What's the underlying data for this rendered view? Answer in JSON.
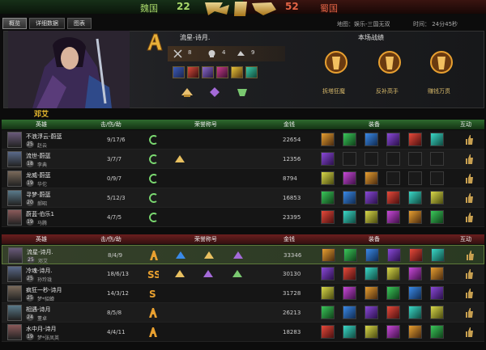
{
  "score": {
    "left_team": "魏国",
    "left_score": "22",
    "right_score": "52",
    "right_team": "蜀国"
  },
  "tabs": [
    {
      "label": "概览"
    },
    {
      "label": "详细数据"
    },
    {
      "label": "图表"
    }
  ],
  "map_info": "地图：娱乐-三国无双",
  "time_info": "时间：  24分45秒",
  "player": {
    "name": "流星-诗月.",
    "kills": "8",
    "deaths": "4",
    "assists": "9"
  },
  "honor_section": {
    "title": "本场战绩",
    "medals": [
      "拆塔狂魔",
      "反补高手",
      "赚钱万贯"
    ]
  },
  "team_hero_label": "邓艾",
  "headers": {
    "hero": "英雄",
    "kda": "击/伤/助",
    "honor": "荣誉称号",
    "gold": "金钱",
    "equip": "装备",
    "interact": "互动"
  },
  "team_green": [
    {
      "name": "不浪浮云-蔚蓝",
      "level": "25",
      "hero": "赵云",
      "kda": "9/17/6",
      "gold": "22654"
    },
    {
      "name": "流世-蔚蓝",
      "level": "18",
      "hero": "李典",
      "kda": "3/7/7",
      "gold": "12356"
    },
    {
      "name": "龙威-蔚蓝",
      "level": "19",
      "hero": "华佗",
      "kda": "0/9/7",
      "gold": "8794"
    },
    {
      "name": "寻梦-蔚蓝",
      "level": "20",
      "hero": "郝昭",
      "kda": "5/12/3",
      "gold": "16853"
    },
    {
      "name": "蔚蓝-伯乐1",
      "level": "19",
      "hero": "马腾",
      "kda": "4/7/5",
      "gold": "23395"
    }
  ],
  "team_red": [
    {
      "name": "流星-诗月.",
      "level": "25",
      "hero": "邓艾",
      "kda": "8/4/9",
      "gold": "33346"
    },
    {
      "name": "冷魂-诗月.",
      "level": "25",
      "hero": "孙玲珑",
      "kda": "18/6/13",
      "gold": "30130"
    },
    {
      "name": "疯狂一秒-诗月",
      "level": "25",
      "hero": "梦*貂蝉",
      "kda": "14/3/12",
      "gold": "31728"
    },
    {
      "name": "相遇-诗月",
      "level": "24",
      "hero": "董卓",
      "kda": "8/5/8",
      "gold": "26213"
    },
    {
      "name": "水中月-诗月",
      "level": "19",
      "hero": "梦*张凤英",
      "kda": "4/4/11",
      "gold": "18283"
    }
  ],
  "colors": {
    "green_team": "#a8d86a",
    "red_team": "#e46446",
    "hero_name": "#f0c030",
    "medal_text": "#d7b96a"
  }
}
